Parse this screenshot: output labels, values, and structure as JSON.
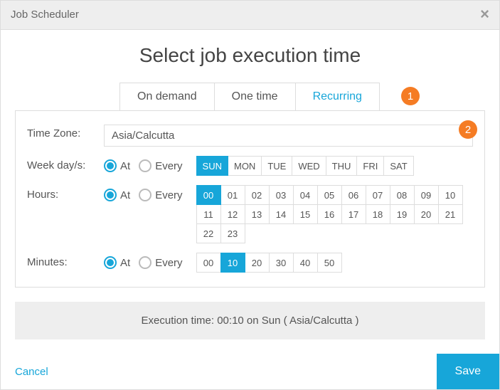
{
  "header": {
    "title": "Job Scheduler"
  },
  "heading": "Select job execution time",
  "tabs": {
    "on_demand": "On demand",
    "one_time": "One time",
    "recurring": "Recurring",
    "active": "recurring"
  },
  "annotations": {
    "one": "1",
    "two": "2"
  },
  "labels": {
    "time_zone": "Time Zone:",
    "week_days": "Week day/s:",
    "hours": "Hours:",
    "minutes": "Minutes:",
    "at": "At",
    "every": "Every"
  },
  "time_zone": {
    "value": "Asia/Calcutta"
  },
  "week_days": {
    "mode": "at",
    "options": [
      "SUN",
      "MON",
      "TUE",
      "WED",
      "THU",
      "FRI",
      "SAT"
    ],
    "selected": [
      "SUN"
    ]
  },
  "hours": {
    "mode": "at",
    "options": [
      "00",
      "01",
      "02",
      "03",
      "04",
      "05",
      "06",
      "07",
      "08",
      "09",
      "10",
      "11",
      "12",
      "13",
      "14",
      "15",
      "16",
      "17",
      "18",
      "19",
      "20",
      "21",
      "22",
      "23"
    ],
    "selected": [
      "00"
    ]
  },
  "minutes": {
    "mode": "at",
    "options": [
      "00",
      "10",
      "20",
      "30",
      "40",
      "50"
    ],
    "selected": [
      "10"
    ]
  },
  "summary": "Execution time: 00:10 on Sun ( Asia/Calcutta )",
  "footer": {
    "cancel": "Cancel",
    "save": "Save"
  }
}
